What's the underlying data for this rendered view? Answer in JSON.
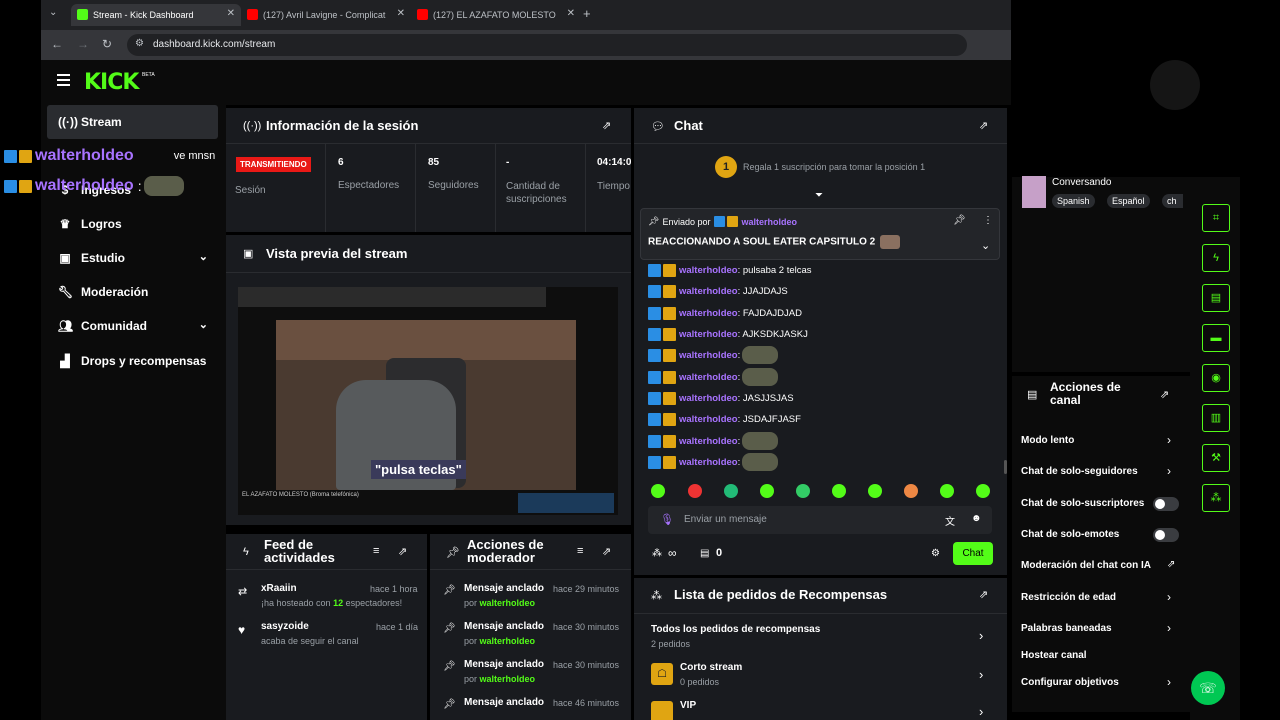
{
  "browser": {
    "tabs": [
      {
        "label": "Stream - Kick Dashboard",
        "fav_color": "#53fc18"
      },
      {
        "label": "(127) Avril Lavigne - Complicat",
        "fav_color": "#ff0000"
      },
      {
        "label": "(127) EL AZAFATO MOLESTO",
        "fav_color": "#ff0000"
      }
    ],
    "url": "dashboard.kick.com/stream",
    "new_tab": "+"
  },
  "brand": {
    "logo": "KICK",
    "beta": "BETA"
  },
  "sidebar": {
    "items": [
      {
        "label": "Stream",
        "icon": "broadcast-icon"
      },
      {
        "label": "Ingresos",
        "icon": "dollar-icon"
      },
      {
        "label": "Logros",
        "icon": "trophy-icon"
      },
      {
        "label": "Estudio",
        "icon": "studio-icon"
      },
      {
        "label": "Moderación",
        "icon": "wrench-icon"
      },
      {
        "label": "Comunidad",
        "icon": "community-icon"
      },
      {
        "label": "Drops y recompensas",
        "icon": "drops-icon"
      }
    ]
  },
  "overlay": {
    "line1_user": "walterholdeo",
    "line1_text": "ve mnsn",
    "line2_user": "walterholdeo",
    "line2_text": ":"
  },
  "session": {
    "title": "Información de la sesión",
    "status": "TRANSMITIENDO",
    "status_label": "Sesión",
    "stats": [
      {
        "value": "6",
        "label": "Espectadores"
      },
      {
        "value": "85",
        "label": "Seguidores"
      },
      {
        "value": "-",
        "label": "Cantidad de suscripciones"
      },
      {
        "value": "04:14:0",
        "label": "Tiempo en vivo"
      }
    ]
  },
  "preview": {
    "title": "Vista previa del stream",
    "caption": "\"pulsa teclas\"",
    "video_title": "EL AZAFATO MOLESTO (Broma telefónica)"
  },
  "chat": {
    "title": "Chat",
    "gift_rank": "1",
    "gift_text": "Regala 1 suscripción para tomar la posición 1",
    "pinned_by_label": "Enviado por",
    "pinned_user": "walterholdeo",
    "pinned_message": "REACCIONANDO A SOUL EATER CAPSITULO 2",
    "messages": [
      {
        "user": "walterholdeo",
        "text": ": pulsaba 2 telcas",
        "emote": false
      },
      {
        "user": "walterholdeo",
        "text": ": JJAJDAJS",
        "emote": false
      },
      {
        "user": "walterholdeo",
        "text": ": FAJDAJDJAD",
        "emote": false
      },
      {
        "user": "walterholdeo",
        "text": ": AJKSDKJASKJ",
        "emote": false
      },
      {
        "user": "walterholdeo",
        "text": ":",
        "emote": true
      },
      {
        "user": "walterholdeo",
        "text": ":",
        "emote": true
      },
      {
        "user": "walterholdeo",
        "text": ": JASJJSJAS",
        "emote": false
      },
      {
        "user": "walterholdeo",
        "text": ": JSDAJFJASF",
        "emote": false
      },
      {
        "user": "walterholdeo",
        "text": ":",
        "emote": true
      },
      {
        "user": "walterholdeo",
        "text": ":",
        "emote": true
      }
    ],
    "input_placeholder": "Enviar un mensaje",
    "viewers_icon_value": "∞",
    "store_value": "0",
    "send_label": "Chat"
  },
  "feed": {
    "title": "Feed de actividades",
    "items": [
      {
        "user": "xRaaiin",
        "time": "hace 1 hora",
        "text_pre": "¡ha hosteado con ",
        "count": "12",
        "text_post": " espectadores!"
      },
      {
        "user": "sasyzoide",
        "time": "hace 1 día",
        "text": "acaba de seguir el canal"
      }
    ]
  },
  "modactions": {
    "title": "Acciones de moderador",
    "items": [
      {
        "label": "Mensaje anclado",
        "time": "hace 29 minutos",
        "by": "por ",
        "user": "walterholdeo"
      },
      {
        "label": "Mensaje anclado",
        "time": "hace 30 minutos",
        "by": "por ",
        "user": "walterholdeo"
      },
      {
        "label": "Mensaje anclado",
        "time": "hace 30 minutos",
        "by": "por ",
        "user": "walterholdeo"
      },
      {
        "label": "Mensaje anclado",
        "time": "hace 46 minutos",
        "by": "",
        "user": ""
      }
    ]
  },
  "rewards": {
    "title": "Lista de pedidos de Recompensas",
    "all_label": "Todos los pedidos de recompensas",
    "all_count": "2 pedidos",
    "items": [
      {
        "label": "Corto stream",
        "count": "0 pedidos"
      },
      {
        "label": "VIP",
        "count": ""
      }
    ]
  },
  "streaminfo": {
    "category": "Conversando",
    "tags": [
      "Spanish",
      "Español",
      "ch"
    ]
  },
  "channel_actions": {
    "title": "Acciones de canal",
    "items": [
      {
        "label": "Modo lento",
        "control": "arrow"
      },
      {
        "label": "Chat de solo-seguidores",
        "control": "arrow"
      },
      {
        "label": "Chat de solo-suscriptores",
        "control": "toggle"
      },
      {
        "label": "Chat de solo-emotes",
        "control": "toggle"
      },
      {
        "label": "Moderación del chat con IA",
        "control": "external"
      },
      {
        "label": "Restricción de edad",
        "control": "arrow"
      },
      {
        "label": "Palabras baneadas",
        "control": "arrow"
      },
      {
        "label": "Hostear canal",
        "control": "none"
      },
      {
        "label": "Configurar objetivos",
        "control": "arrow"
      }
    ]
  },
  "right_rail": {
    "buttons": [
      "scan-icon",
      "bolt-icon",
      "document-icon",
      "chat-bubble-icon",
      "broadcast-icon",
      "stack-icon",
      "wrench-icon",
      "drops-icon"
    ]
  },
  "colors": {
    "accent": "#53fc18",
    "panel": "#191b1f",
    "username": "#a873ff",
    "live": "#e91916"
  }
}
